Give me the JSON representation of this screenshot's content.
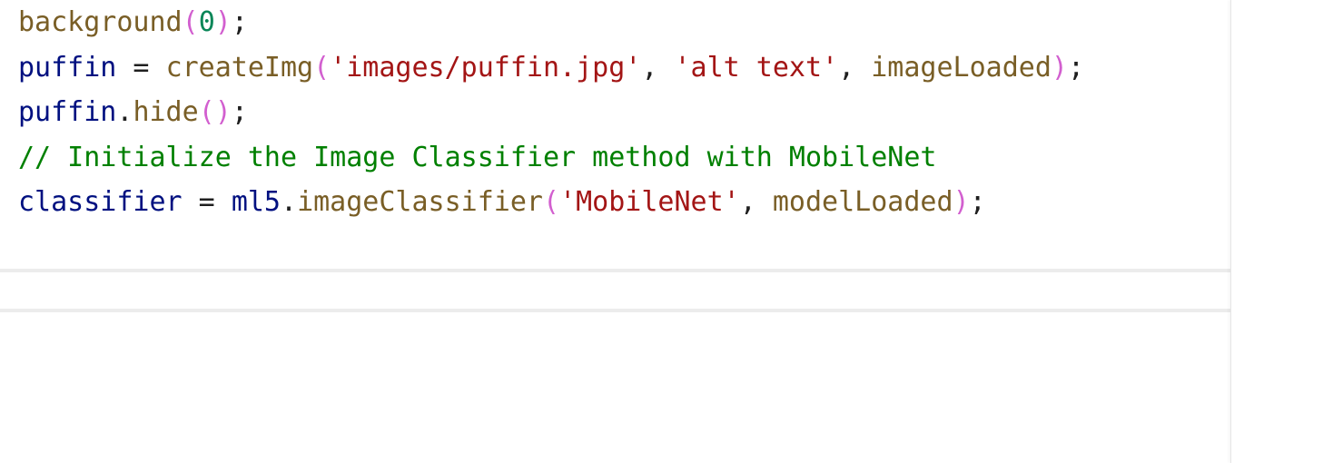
{
  "code": {
    "lines": [
      {
        "tokens": [
          {
            "text": "background",
            "kind": "fn"
          },
          {
            "text": "(",
            "kind": "paren"
          },
          {
            "text": "0",
            "kind": "num"
          },
          {
            "text": ")",
            "kind": "paren"
          },
          {
            "text": ";",
            "kind": "punc"
          }
        ]
      },
      {
        "tokens": [
          {
            "text": "puffin",
            "kind": "var"
          },
          {
            "text": " = ",
            "kind": "op"
          },
          {
            "text": "createImg",
            "kind": "fn"
          },
          {
            "text": "(",
            "kind": "paren"
          },
          {
            "text": "'images/puffin.jpg'",
            "kind": "str"
          },
          {
            "text": ", ",
            "kind": "punc"
          },
          {
            "text": "'alt text'",
            "kind": "str"
          },
          {
            "text": ", ",
            "kind": "punc"
          },
          {
            "text": "imageLoaded",
            "kind": "fn"
          },
          {
            "text": ")",
            "kind": "paren"
          },
          {
            "text": ";",
            "kind": "punc"
          }
        ]
      },
      {
        "tokens": [
          {
            "text": "puffin",
            "kind": "var"
          },
          {
            "text": ".",
            "kind": "punc"
          },
          {
            "text": "hide",
            "kind": "fn"
          },
          {
            "text": "()",
            "kind": "paren"
          },
          {
            "text": ";",
            "kind": "punc"
          }
        ]
      },
      {
        "tokens": [
          {
            "text": "// Initialize the Image Classifier method with MobileNet",
            "kind": "comment"
          }
        ]
      },
      {
        "tokens": [
          {
            "text": "classifier",
            "kind": "var"
          },
          {
            "text": " = ",
            "kind": "op"
          },
          {
            "text": "ml5",
            "kind": "var"
          },
          {
            "text": ".",
            "kind": "punc"
          },
          {
            "text": "imageClassifier",
            "kind": "fn"
          },
          {
            "text": "(",
            "kind": "paren"
          },
          {
            "text": "'MobileNet'",
            "kind": "str"
          },
          {
            "text": ", ",
            "kind": "punc"
          },
          {
            "text": "modelLoaded",
            "kind": "fn"
          },
          {
            "text": ")",
            "kind": "paren"
          },
          {
            "text": ";",
            "kind": "punc"
          }
        ]
      }
    ]
  },
  "colors": {
    "variable": "#001080",
    "function": "#795e26",
    "string": "#a31515",
    "number": "#098658",
    "paren": "#d25fcf",
    "comment": "#008000",
    "divider": "#ececec"
  }
}
